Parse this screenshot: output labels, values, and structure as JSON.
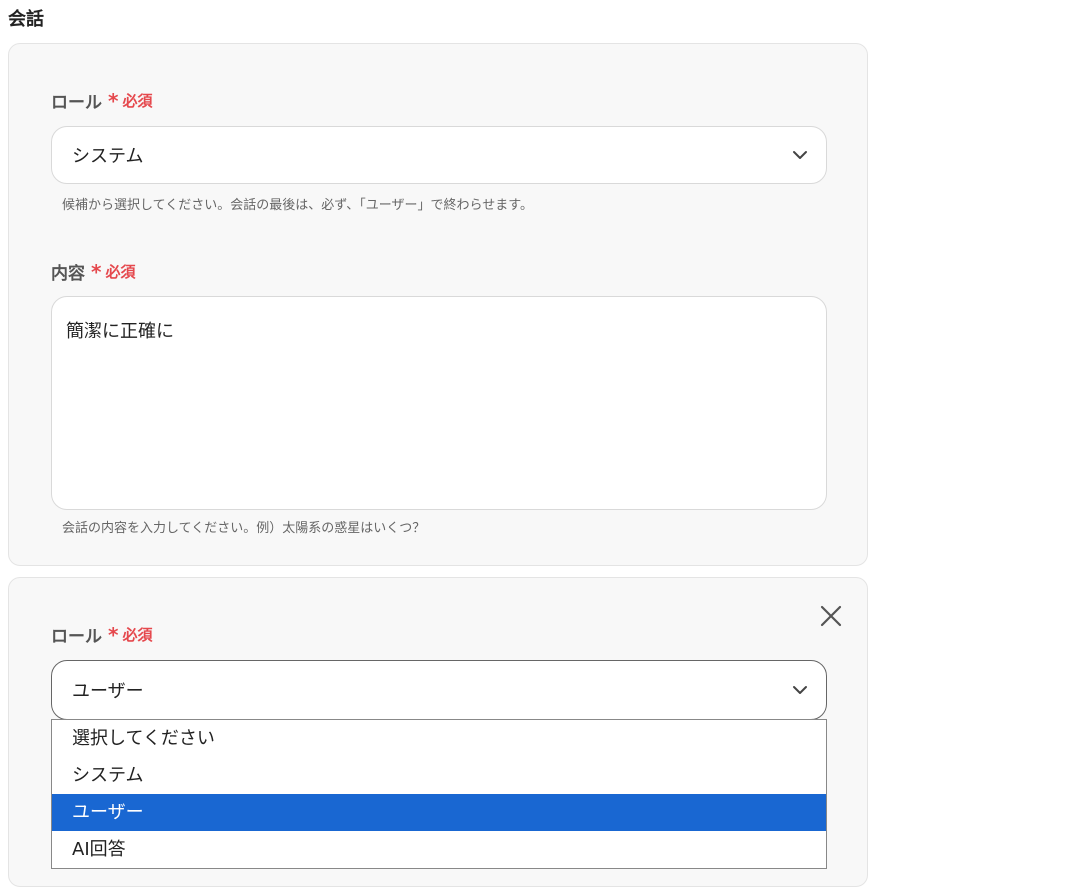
{
  "page": {
    "title": "会話"
  },
  "conversation": [
    {
      "role_label": "ロール",
      "required_star": "*",
      "required_text": "必須",
      "role_value": "システム",
      "role_help": "候補から選択してください。会話の最後は、必ず、「ユーザー」で終わらせます。",
      "content_label": "内容",
      "content_value": "簡潔に正確に",
      "content_help": "会話の内容を入力してください。例）太陽系の惑星はいくつ？"
    },
    {
      "role_label": "ロール",
      "required_star": "*",
      "required_text": "必須",
      "role_value": "ユーザー"
    }
  ],
  "role_dropdown": {
    "options": [
      "選択してください",
      "システム",
      "ユーザー",
      "AI回答"
    ],
    "selected": "ユーザー"
  },
  "colors": {
    "required": "#e5484d",
    "selected_option": "#1967d2"
  },
  "icons": {
    "chevron": "chevron-down-icon",
    "close": "close-icon"
  }
}
